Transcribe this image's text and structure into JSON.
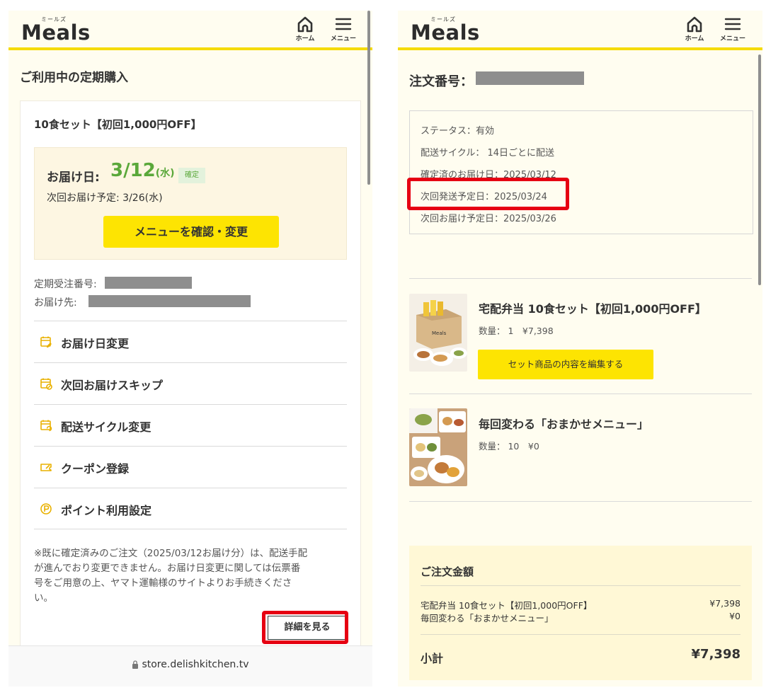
{
  "header": {
    "logo_ruby": "ミールズ",
    "logo": "Meals",
    "home_label": "ホーム",
    "menu_label": "メニュー"
  },
  "left": {
    "page_title": "ご利用中の定期購入",
    "plan_name": "10食セット【初回1,000円OFF】",
    "delivery_label": "お届け日:",
    "delivery_date": "3/12",
    "delivery_dow": "(水)",
    "confirmed_badge": "確定",
    "next_delivery": "次回お届け予定: 3/26(水)",
    "menu_change_button": "メニューを確認・変更",
    "order_number_label": "定期受注番号:",
    "destination_label": "お届け先:",
    "actions": [
      {
        "label": "お届け日変更",
        "icon": "calendar-edit-icon"
      },
      {
        "label": "次回お届けスキップ",
        "icon": "calendar-skip-icon"
      },
      {
        "label": "配送サイクル変更",
        "icon": "calendar-cycle-icon"
      },
      {
        "label": "クーポン登録",
        "icon": "coupon-icon"
      },
      {
        "label": "ポイント利用設定",
        "icon": "point-icon"
      }
    ],
    "notice_lines": [
      "※既に確定済みのご注文（2025/03/12お届け分）は、配送手配",
      "が進んでおり変更できません。お届け日変更に関しては伝票番",
      "号をご用意の上、ヤマト運輸様のサイトよりお手続きくださ",
      "い。"
    ],
    "detail_button": "詳細を見る",
    "url": "store.delishkitchen.tv"
  },
  "right": {
    "order_title": "注文番号：",
    "status_rows": [
      "ステータス：有効",
      "配送サイクル： 14日ごとに配送",
      "確定済のお届け日：2025/03/12",
      "次回発送予定日：2025/03/24",
      "次回お届け予定日：2025/03/26"
    ],
    "products": [
      {
        "name": "宅配弁当 10食セット【初回1,000円OFF】",
        "qty": "数量： 1　¥7,398"
      },
      {
        "name": "毎回変わる「おまかせメニュー」",
        "qty": "数量： 10　¥0"
      }
    ],
    "edit_set_button": "セット商品の内容を編集する",
    "total": {
      "title": "ご注文金額",
      "rows": [
        {
          "label": "宅配弁当 10食セット【初回1,000円OFF】",
          "amount": "¥7,398"
        },
        {
          "label": "毎回変わる「おまかせメニュー」",
          "amount": "¥0"
        }
      ],
      "subtotal_label": "小計",
      "subtotal_amount": "¥7,398"
    }
  },
  "colors": {
    "accent_yellow": "#fde402",
    "header_line": "#f5db00",
    "confirm_green": "#5aa83a",
    "highlight_red": "#e60012",
    "background": "#fffdf0"
  }
}
